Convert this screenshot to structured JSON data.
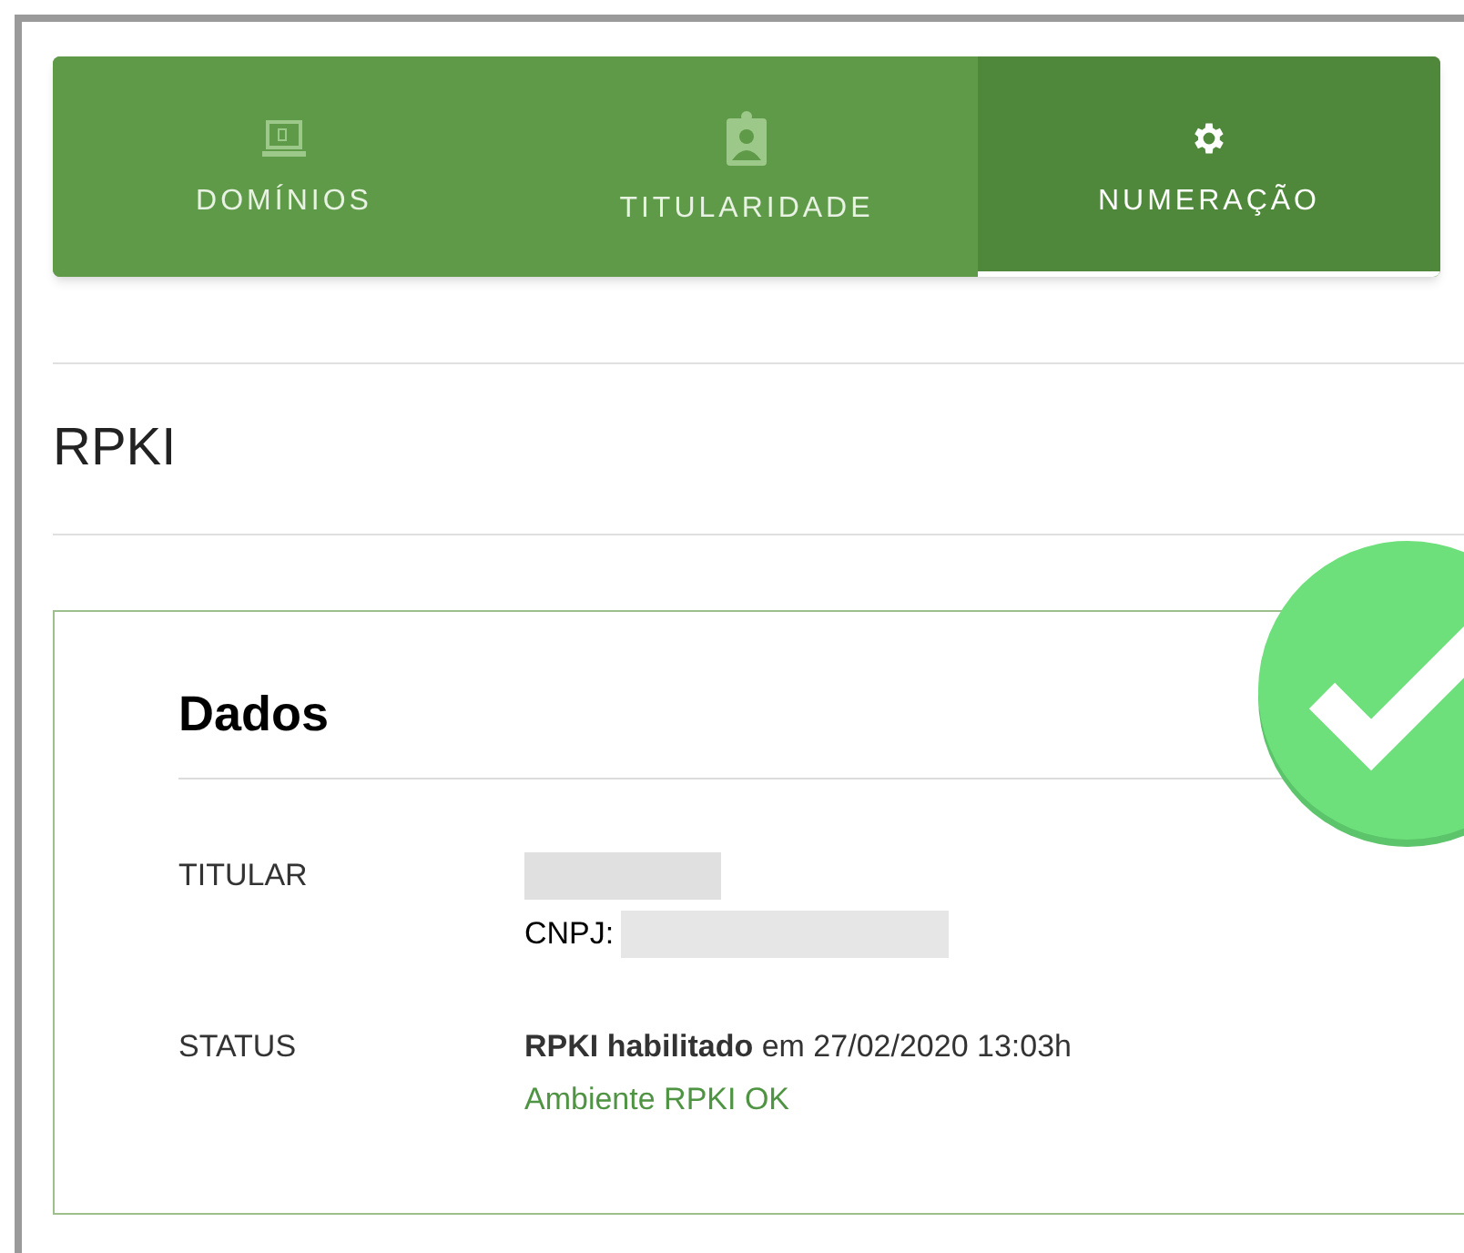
{
  "tabs": [
    {
      "label": "DOMÍNIOS",
      "selected": false
    },
    {
      "label": "TITULARIDADE",
      "selected": false
    },
    {
      "label": "NUMERAÇÃO",
      "selected": true
    }
  ],
  "section_title": "RPKI",
  "card": {
    "title": "Dados",
    "rows": [
      {
        "kind": "titular",
        "label": "TITULAR",
        "cnpj_label": "CNPJ:"
      },
      {
        "kind": "status",
        "label": "STATUS",
        "value": "**RPKI habilitado** em 27/02/2020 13:03h",
        "note": "Ambiente RPKI OK"
      }
    ]
  }
}
